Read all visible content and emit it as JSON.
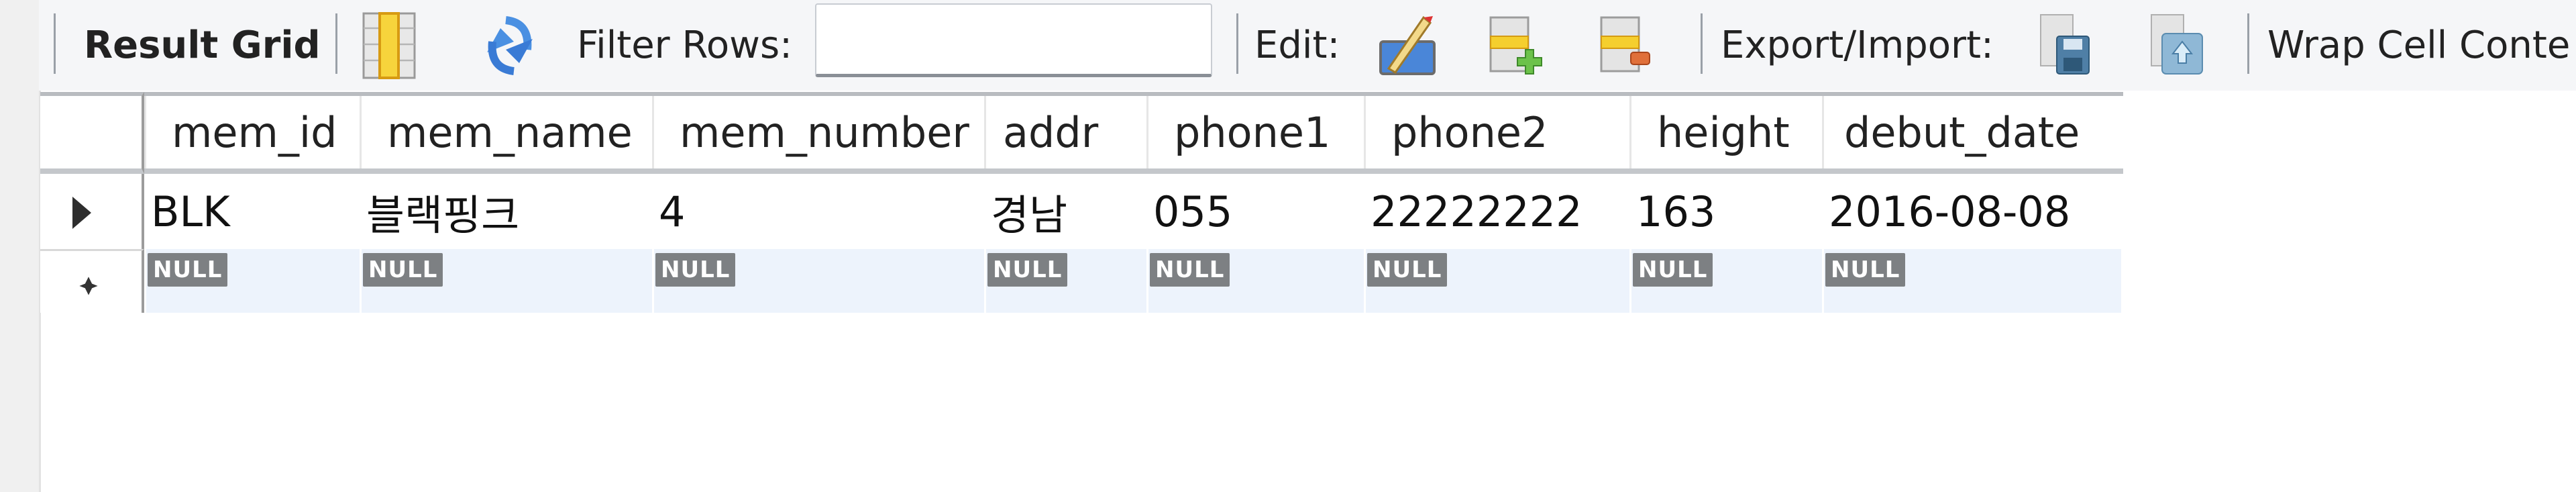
{
  "toolbar": {
    "result_grid_label": "Result Grid",
    "filter_rows_label": "Filter Rows:",
    "filter_rows_value": "",
    "edit_label": "Edit:",
    "export_import_label": "Export/Import:",
    "wrap_cell_label": "Wrap Cell Conte",
    "icons": {
      "grid_toggle": "column-grid-icon",
      "refresh": "refresh-icon",
      "edit_cell": "edit-pencil-icon",
      "add_row": "add-row-icon",
      "delete_row": "delete-row-icon",
      "export": "export-save-icon",
      "import": "import-icon"
    },
    "colors": {
      "toolbar_bg": "#f5f6f8",
      "accent_blue": "#3a7bd5",
      "yellow": "#f2c418",
      "green": "#5cb85c",
      "orange": "#e0703a"
    }
  },
  "grid": {
    "columns": [
      "mem_id",
      "mem_name",
      "mem_number",
      "addr",
      "phone1",
      "phone2",
      "height",
      "debut_date"
    ],
    "rows": [
      {
        "marker": "current-row-arrow",
        "cells": [
          "BLK",
          "블랙핑크",
          "4",
          "경남",
          "055",
          "22222222",
          "163",
          "2016-08-08"
        ]
      }
    ],
    "new_row": {
      "marker": "new-row-asterisk",
      "cells": [
        "NULL",
        "NULL",
        "NULL",
        "NULL",
        "NULL",
        "NULL",
        "NULL",
        "NULL"
      ]
    },
    "colors": {
      "null_badge": "#7d8083",
      "new_row_bg": "#edf3fc"
    }
  }
}
